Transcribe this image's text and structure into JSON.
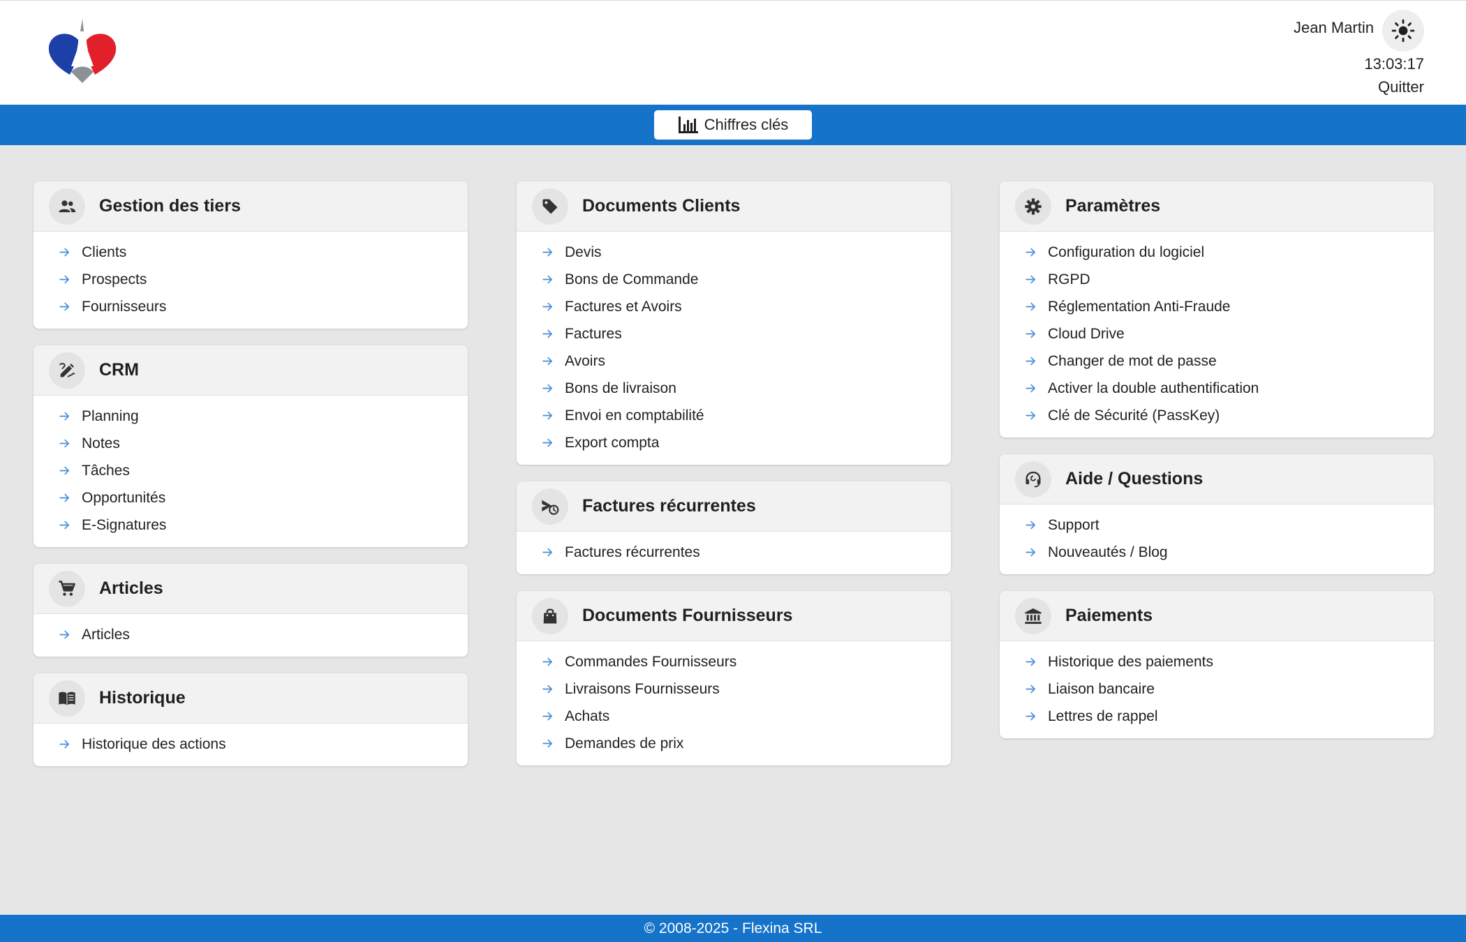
{
  "header": {
    "user_name": "Jean Martin",
    "time": "13:03:17",
    "quit_label": "Quitter",
    "theme_icon": "sun-icon"
  },
  "toolbar": {
    "key_figures_label": "Chiffres clés",
    "key_figures_icon": "bar-chart-icon"
  },
  "colors": {
    "primary": "#1573c9",
    "background": "#e6e6e6",
    "arrow": "#4a8fd6"
  },
  "columns": [
    [
      {
        "title": "Gestion des tiers",
        "icon": "users-icon",
        "items": [
          "Clients",
          "Prospects",
          "Fournisseurs"
        ]
      },
      {
        "title": "CRM",
        "icon": "edit-note-icon",
        "items": [
          "Planning",
          "Notes",
          "Tâches",
          "Opportunités",
          "E-Signatures"
        ]
      },
      {
        "title": "Articles",
        "icon": "cart-icon",
        "items": [
          "Articles"
        ]
      },
      {
        "title": "Historique",
        "icon": "book-icon",
        "items": [
          "Historique des actions"
        ]
      }
    ],
    [
      {
        "title": "Documents Clients",
        "icon": "tag-icon",
        "items": [
          "Devis",
          "Bons de Commande",
          "Factures et Avoirs",
          "Factures",
          "Avoirs",
          "Bons de livraison",
          "Envoi en comptabilité",
          "Export compta"
        ]
      },
      {
        "title": "Factures récurrentes",
        "icon": "recurring-icon",
        "items": [
          "Factures récurrentes"
        ]
      },
      {
        "title": "Documents Fournisseurs",
        "icon": "bag-icon",
        "items": [
          "Commandes Fournisseurs",
          "Livraisons Fournisseurs",
          "Achats",
          "Demandes de prix"
        ]
      }
    ],
    [
      {
        "title": "Paramètres",
        "icon": "gear-icon",
        "items": [
          "Configuration du logiciel",
          "RGPD",
          "Réglementation Anti-Fraude",
          "Cloud Drive",
          "Changer de mot de passe",
          "Activer la double authentification",
          "Clé de Sécurité (PassKey)"
        ]
      },
      {
        "title": "Aide / Questions",
        "icon": "headset-icon",
        "items": [
          "Support",
          "Nouveautés / Blog"
        ]
      },
      {
        "title": "Paiements",
        "icon": "bank-icon",
        "items": [
          "Historique des paiements",
          "Liaison bancaire",
          "Lettres de rappel"
        ]
      }
    ]
  ],
  "footer": {
    "copyright": "© 2008-2025 - Flexina SRL"
  }
}
